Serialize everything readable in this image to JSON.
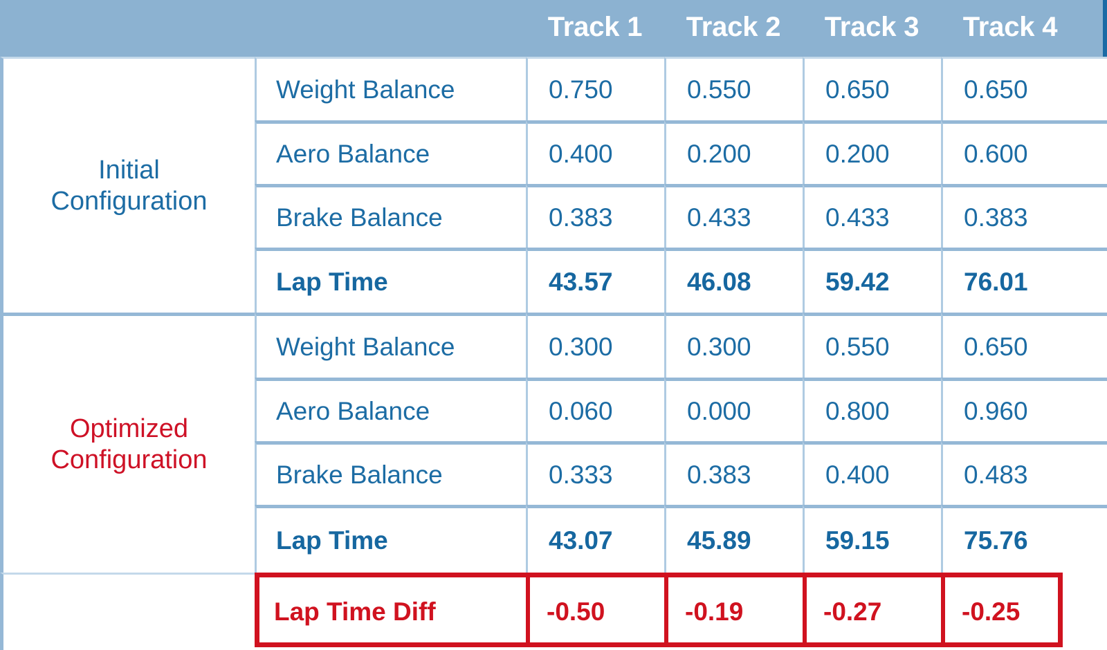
{
  "table": {
    "column_headers": [
      "",
      "",
      "Track 1",
      "Track 2",
      "Track 3",
      "Track 4"
    ],
    "tracks": [
      "Track 1",
      "Track 2",
      "Track 3",
      "Track 4"
    ],
    "groups": [
      {
        "label_line1": "Initial",
        "label_line2": "Configuration",
        "label_color": "#1C6CA4",
        "rows": [
          {
            "parameter": "Weight Balance",
            "values": [
              "0.750",
              "0.550",
              "0.650",
              "0.650"
            ]
          },
          {
            "parameter": "Aero Balance",
            "values": [
              "0.400",
              "0.200",
              "0.200",
              "0.600"
            ]
          },
          {
            "parameter": "Brake Balance",
            "values": [
              "0.383",
              "0.433",
              "0.433",
              "0.383"
            ]
          },
          {
            "parameter": "Lap Time",
            "values": [
              "43.57",
              "46.08",
              "59.42",
              "76.01"
            ]
          }
        ]
      },
      {
        "label_line1": "Optimized",
        "label_line2": "Configuration",
        "label_color": "#CE1126",
        "rows": [
          {
            "parameter": "Weight Balance",
            "values": [
              "0.300",
              "0.300",
              "0.550",
              "0.650"
            ]
          },
          {
            "parameter": "Aero Balance",
            "values": [
              "0.060",
              "0.000",
              "0.800",
              "0.960"
            ]
          },
          {
            "parameter": "Brake Balance",
            "values": [
              "0.333",
              "0.383",
              "0.400",
              "0.483"
            ]
          },
          {
            "parameter": "Lap Time",
            "values": [
              "43.07",
              "45.89",
              "59.15",
              "75.76"
            ]
          }
        ]
      }
    ],
    "diff_row": {
      "parameter": "Lap Time Diff",
      "values": [
        "-0.50",
        "-0.19",
        "-0.27",
        "-0.25"
      ]
    },
    "colors": {
      "header_background": "#8CB2D1",
      "header_text": "#FFFFFF",
      "grid_border": "#95B8D6",
      "value_blue": "#1C6CA4",
      "accent_red": "#CE1126",
      "cell_background": "#FFFFFF"
    }
  },
  "chart_data": {
    "type": "table",
    "title": "",
    "categories": [
      "Track 1",
      "Track 2",
      "Track 3",
      "Track 4"
    ],
    "series": [
      {
        "name": "Initial Weight Balance",
        "values": [
          0.75,
          0.55,
          0.65,
          0.65
        ]
      },
      {
        "name": "Initial Aero Balance",
        "values": [
          0.4,
          0.2,
          0.2,
          0.6
        ]
      },
      {
        "name": "Initial Brake Balance",
        "values": [
          0.383,
          0.433,
          0.433,
          0.383
        ]
      },
      {
        "name": "Initial Lap Time",
        "values": [
          43.57,
          46.08,
          59.42,
          76.01
        ]
      },
      {
        "name": "Optimized Weight Balance",
        "values": [
          0.3,
          0.3,
          0.55,
          0.65
        ]
      },
      {
        "name": "Optimized Aero Balance",
        "values": [
          0.06,
          0.0,
          0.8,
          0.96
        ]
      },
      {
        "name": "Optimized Brake Balance",
        "values": [
          0.333,
          0.383,
          0.4,
          0.483
        ]
      },
      {
        "name": "Optimized Lap Time",
        "values": [
          43.07,
          45.89,
          59.15,
          75.76
        ]
      },
      {
        "name": "Lap Time Diff",
        "values": [
          -0.5,
          -0.19,
          -0.27,
          -0.25
        ]
      }
    ]
  }
}
